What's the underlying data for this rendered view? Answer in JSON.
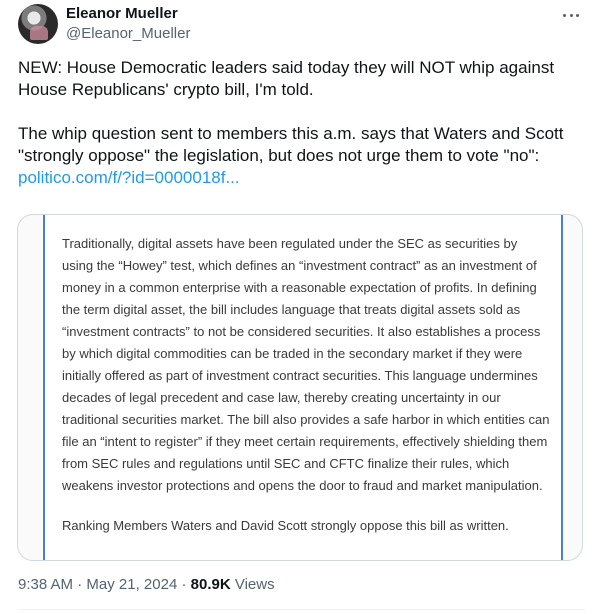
{
  "author": {
    "display_name": "Eleanor Mueller",
    "handle": "@Eleanor_Mueller"
  },
  "tweet": {
    "paragraph_1": "NEW: House Democratic leaders said today they will NOT whip against House Republicans' crypto bill, I'm told.",
    "paragraph_2": "The whip question sent to members this a.m. says that Waters and Scott \"strongly oppose\" the legislation, but does not urge them to vote \"no\":",
    "link_text": "politico.com/f/?id=0000018f..."
  },
  "image": {
    "body": "Traditionally, digital assets have been regulated under the SEC as securities by using the “Howey” test, which defines an “investment contract” as an investment of money in a common enterprise with a reasonable expectation of profits. In defining the term digital asset, the bill includes language that treats digital assets sold as “investment contracts” to not be considered securities. It also establishes a process by which digital commodities can be traded in the secondary market if they were initially offered as part of investment contract securities. This language undermines decades of legal precedent and case law, thereby creating uncertainty in our traditional securities market. The bill also provides a safe harbor in which entities can file an “intent to register” if they meet certain requirements, effectively shielding them from SEC rules and regulations until SEC and CFTC finalize their rules, which weakens investor protections and opens the door to fraud and market manipulation.",
    "closing": "Ranking Members Waters and David Scott strongly oppose this bill as written."
  },
  "meta": {
    "time": "9:38 AM",
    "separator": "·",
    "date": "May 21, 2024",
    "views_count": "80.9K",
    "views_label": "Views"
  },
  "colors": {
    "link": "#1d9bf0",
    "secondary_text": "#536471",
    "doc_border": "#4a7fd6"
  }
}
